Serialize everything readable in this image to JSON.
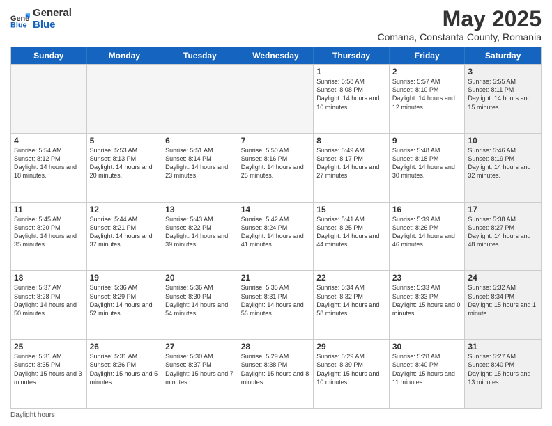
{
  "logo": {
    "general": "General",
    "blue": "Blue"
  },
  "header": {
    "month": "May 2025",
    "location": "Comana, Constanta County, Romania"
  },
  "weekdays": [
    "Sunday",
    "Monday",
    "Tuesday",
    "Wednesday",
    "Thursday",
    "Friday",
    "Saturday"
  ],
  "rows": [
    [
      {
        "day": "",
        "empty": true
      },
      {
        "day": "",
        "empty": true
      },
      {
        "day": "",
        "empty": true
      },
      {
        "day": "",
        "empty": true
      },
      {
        "day": "1",
        "sunrise": "5:58 AM",
        "sunset": "8:08 PM",
        "daylight": "14 hours and 10 minutes."
      },
      {
        "day": "2",
        "sunrise": "5:57 AM",
        "sunset": "8:10 PM",
        "daylight": "14 hours and 12 minutes."
      },
      {
        "day": "3",
        "sunrise": "5:55 AM",
        "sunset": "8:11 PM",
        "daylight": "14 hours and 15 minutes.",
        "shaded": true
      }
    ],
    [
      {
        "day": "4",
        "sunrise": "5:54 AM",
        "sunset": "8:12 PM",
        "daylight": "14 hours and 18 minutes."
      },
      {
        "day": "5",
        "sunrise": "5:53 AM",
        "sunset": "8:13 PM",
        "daylight": "14 hours and 20 minutes."
      },
      {
        "day": "6",
        "sunrise": "5:51 AM",
        "sunset": "8:14 PM",
        "daylight": "14 hours and 23 minutes."
      },
      {
        "day": "7",
        "sunrise": "5:50 AM",
        "sunset": "8:16 PM",
        "daylight": "14 hours and 25 minutes."
      },
      {
        "day": "8",
        "sunrise": "5:49 AM",
        "sunset": "8:17 PM",
        "daylight": "14 hours and 27 minutes."
      },
      {
        "day": "9",
        "sunrise": "5:48 AM",
        "sunset": "8:18 PM",
        "daylight": "14 hours and 30 minutes."
      },
      {
        "day": "10",
        "sunrise": "5:46 AM",
        "sunset": "8:19 PM",
        "daylight": "14 hours and 32 minutes.",
        "shaded": true
      }
    ],
    [
      {
        "day": "11",
        "sunrise": "5:45 AM",
        "sunset": "8:20 PM",
        "daylight": "14 hours and 35 minutes."
      },
      {
        "day": "12",
        "sunrise": "5:44 AM",
        "sunset": "8:21 PM",
        "daylight": "14 hours and 37 minutes."
      },
      {
        "day": "13",
        "sunrise": "5:43 AM",
        "sunset": "8:22 PM",
        "daylight": "14 hours and 39 minutes."
      },
      {
        "day": "14",
        "sunrise": "5:42 AM",
        "sunset": "8:24 PM",
        "daylight": "14 hours and 41 minutes."
      },
      {
        "day": "15",
        "sunrise": "5:41 AM",
        "sunset": "8:25 PM",
        "daylight": "14 hours and 44 minutes."
      },
      {
        "day": "16",
        "sunrise": "5:39 AM",
        "sunset": "8:26 PM",
        "daylight": "14 hours and 46 minutes."
      },
      {
        "day": "17",
        "sunrise": "5:38 AM",
        "sunset": "8:27 PM",
        "daylight": "14 hours and 48 minutes.",
        "shaded": true
      }
    ],
    [
      {
        "day": "18",
        "sunrise": "5:37 AM",
        "sunset": "8:28 PM",
        "daylight": "14 hours and 50 minutes."
      },
      {
        "day": "19",
        "sunrise": "5:36 AM",
        "sunset": "8:29 PM",
        "daylight": "14 hours and 52 minutes."
      },
      {
        "day": "20",
        "sunrise": "5:36 AM",
        "sunset": "8:30 PM",
        "daylight": "14 hours and 54 minutes."
      },
      {
        "day": "21",
        "sunrise": "5:35 AM",
        "sunset": "8:31 PM",
        "daylight": "14 hours and 56 minutes."
      },
      {
        "day": "22",
        "sunrise": "5:34 AM",
        "sunset": "8:32 PM",
        "daylight": "14 hours and 58 minutes."
      },
      {
        "day": "23",
        "sunrise": "5:33 AM",
        "sunset": "8:33 PM",
        "daylight": "15 hours and 0 minutes."
      },
      {
        "day": "24",
        "sunrise": "5:32 AM",
        "sunset": "8:34 PM",
        "daylight": "15 hours and 1 minute.",
        "shaded": true
      }
    ],
    [
      {
        "day": "25",
        "sunrise": "5:31 AM",
        "sunset": "8:35 PM",
        "daylight": "15 hours and 3 minutes."
      },
      {
        "day": "26",
        "sunrise": "5:31 AM",
        "sunset": "8:36 PM",
        "daylight": "15 hours and 5 minutes."
      },
      {
        "day": "27",
        "sunrise": "5:30 AM",
        "sunset": "8:37 PM",
        "daylight": "15 hours and 7 minutes."
      },
      {
        "day": "28",
        "sunrise": "5:29 AM",
        "sunset": "8:38 PM",
        "daylight": "15 hours and 8 minutes."
      },
      {
        "day": "29",
        "sunrise": "5:29 AM",
        "sunset": "8:39 PM",
        "daylight": "15 hours and 10 minutes."
      },
      {
        "day": "30",
        "sunrise": "5:28 AM",
        "sunset": "8:40 PM",
        "daylight": "15 hours and 11 minutes."
      },
      {
        "day": "31",
        "sunrise": "5:27 AM",
        "sunset": "8:40 PM",
        "daylight": "15 hours and 13 minutes.",
        "shaded": true
      }
    ]
  ],
  "footer": {
    "daylight_label": "Daylight hours"
  }
}
